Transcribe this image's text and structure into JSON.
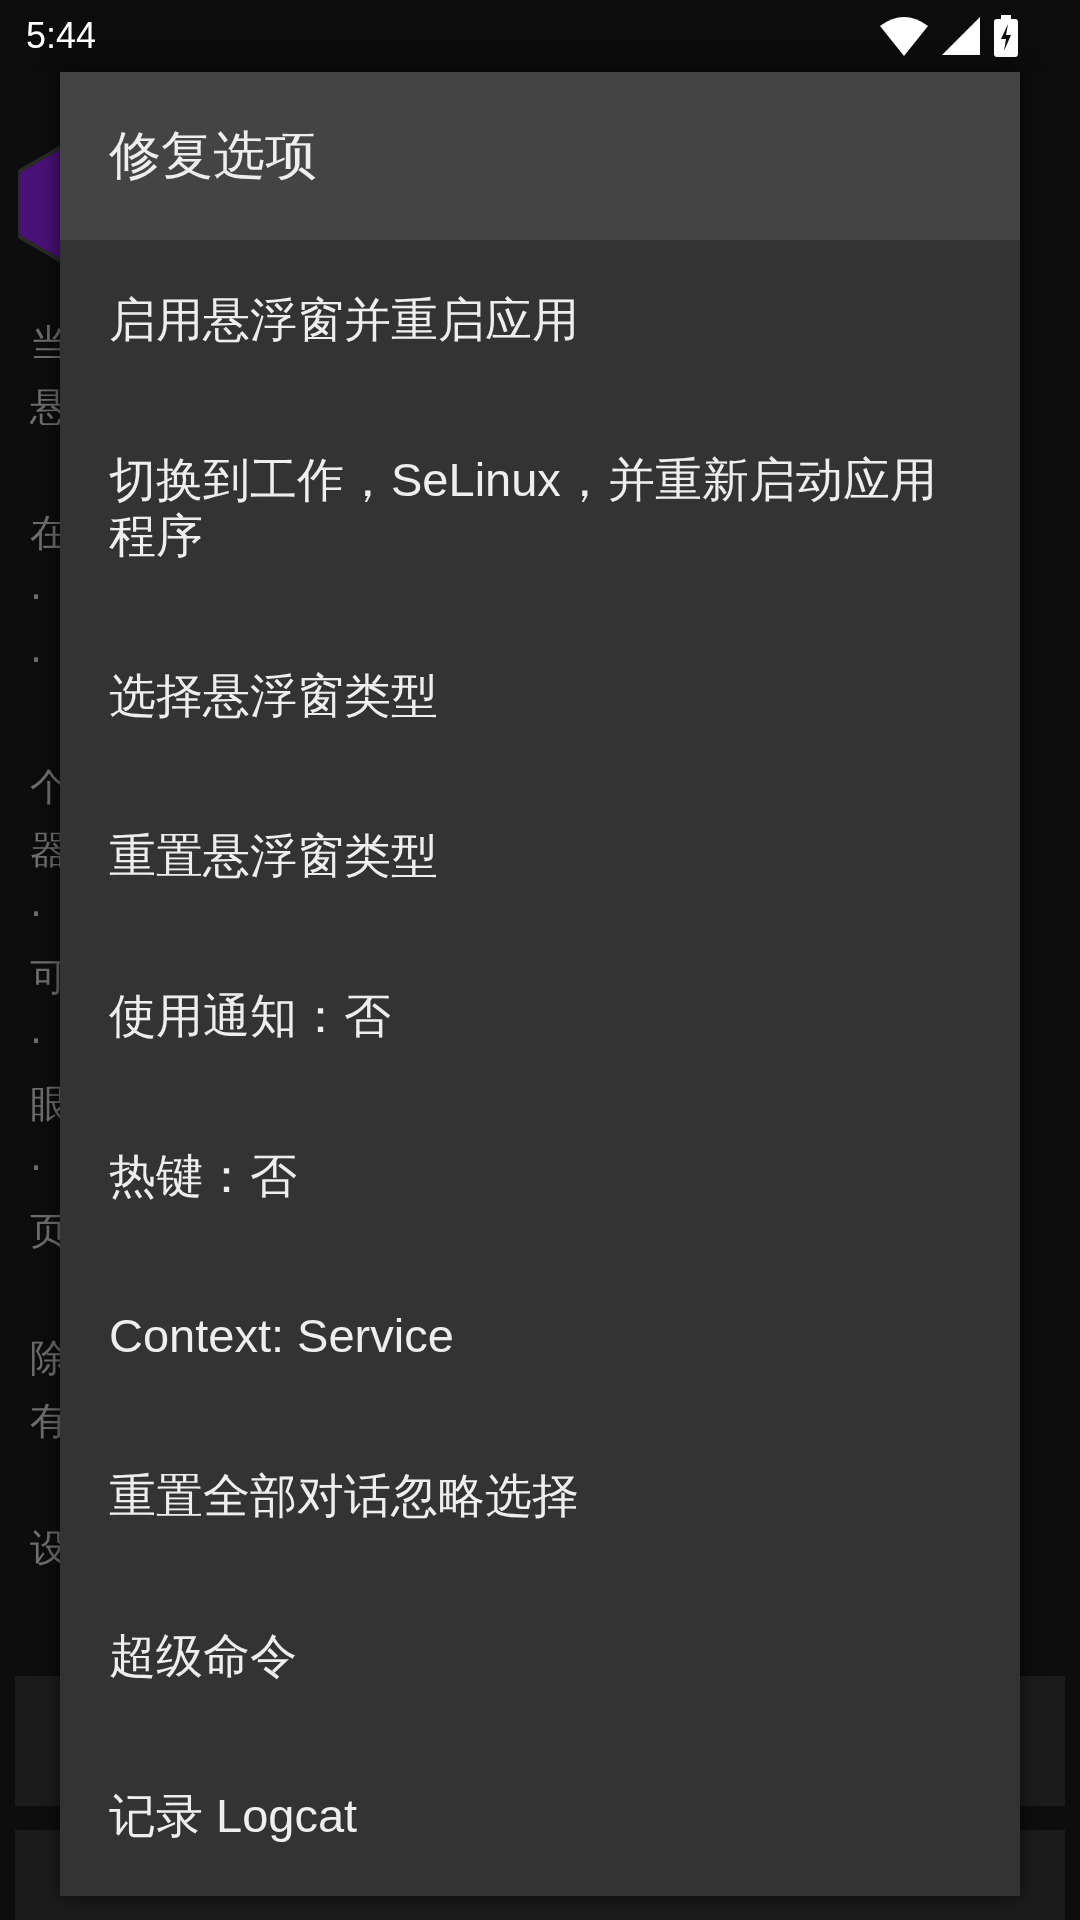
{
  "status_bar": {
    "time": "5:44"
  },
  "background": {
    "paragraphs": [
      [
        "当",
        "悬"
      ],
      [
        "在",
        "·",
        "·"
      ],
      [
        "个",
        "器",
        "·",
        "可",
        "·",
        "眼",
        "·",
        "页"
      ],
      [
        "除",
        "有"
      ],
      [
        "设"
      ]
    ]
  },
  "dialog": {
    "title": "修复选项",
    "items": [
      {
        "label": "启用悬浮窗并重启应用"
      },
      {
        "label": "切换到工作，SeLinux，并重新启动应用程序"
      },
      {
        "label": "选择悬浮窗类型"
      },
      {
        "label": "重置悬浮窗类型"
      },
      {
        "label": "使用通知：否"
      },
      {
        "label": "热键：否"
      },
      {
        "label": "Context: Service"
      },
      {
        "label": "重置全部对话忽略选择"
      },
      {
        "label": "超级命令"
      },
      {
        "label": "记录 Logcat"
      }
    ]
  }
}
